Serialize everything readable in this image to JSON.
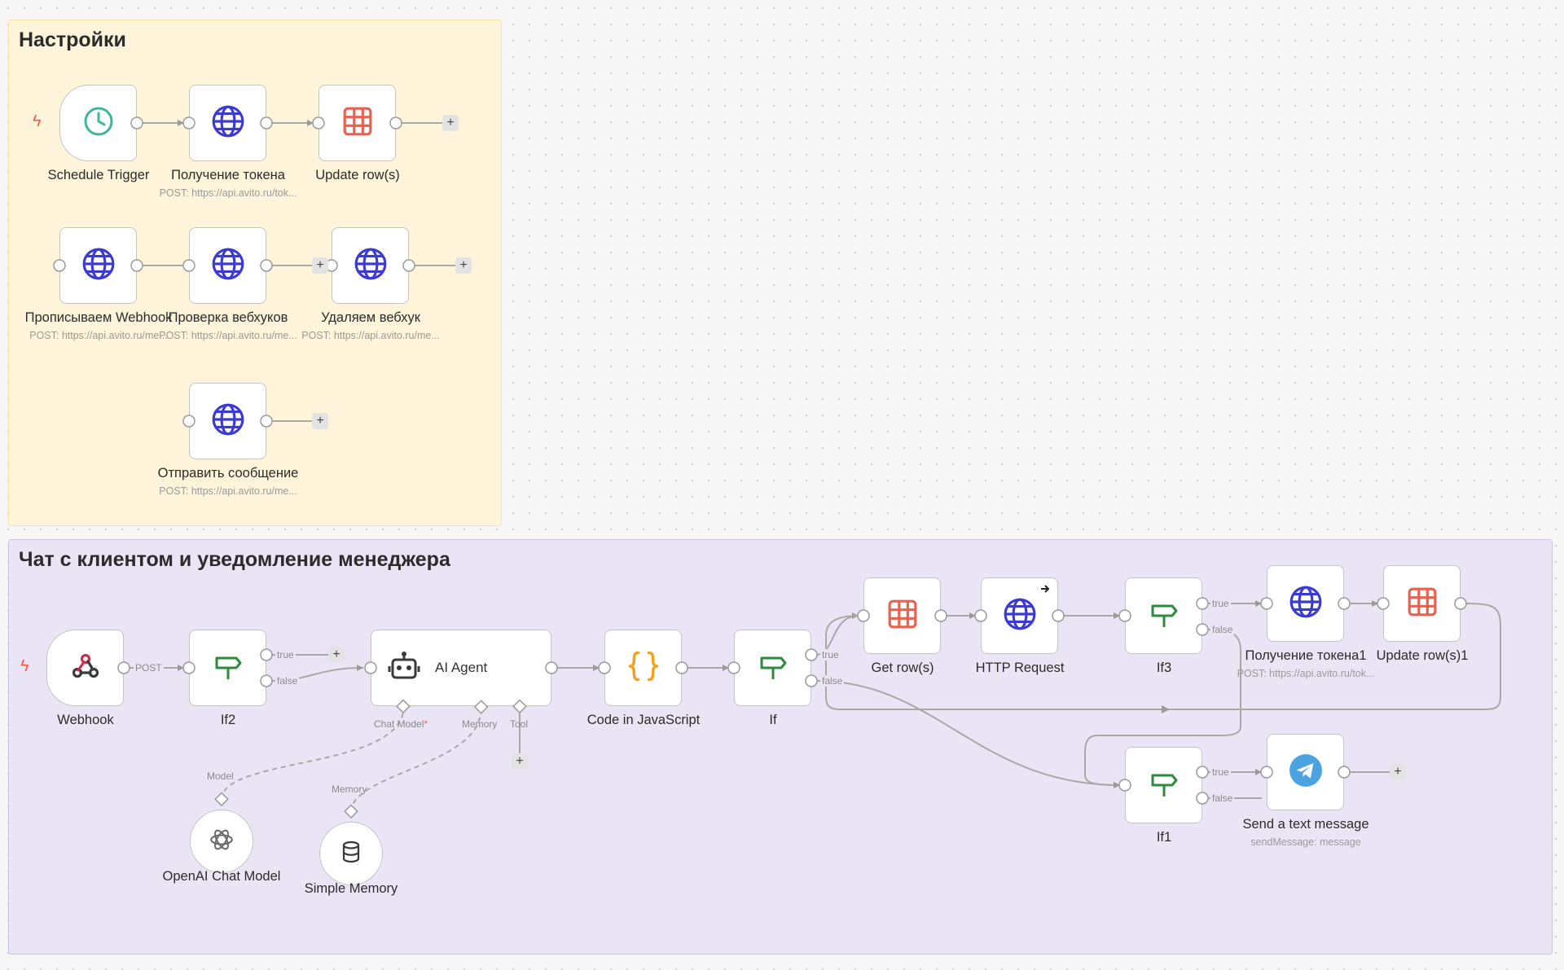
{
  "sticky_settings": {
    "title": "Настройки"
  },
  "sticky_chat": {
    "title": "Чат с клиентом и уведомление менеджера"
  },
  "nodes": {
    "schedule_trigger": {
      "label": "Schedule Trigger",
      "icon": "clock-icon"
    },
    "get_token": {
      "label": "Получение токена",
      "sub": "POST: https://api.avito.ru/tok...",
      "icon": "globe-icon"
    },
    "update_rows": {
      "label": "Update row(s)",
      "icon": "sheet-icon"
    },
    "register_webhook": {
      "label": "Прописываем Webhook",
      "sub": "POST: https://api.avito.ru/me...",
      "icon": "globe-icon"
    },
    "check_webhooks": {
      "label": "Проверка вебхуков",
      "sub": "POST: https://api.avito.ru/me...",
      "icon": "globe-icon"
    },
    "delete_webhook": {
      "label": "Удаляем вебхук",
      "sub": "POST: https://api.avito.ru/me...",
      "icon": "globe-icon"
    },
    "send_message_ru": {
      "label": "Отправить сообщение",
      "sub": "POST: https://api.avito.ru/me...",
      "icon": "globe-icon"
    },
    "webhook": {
      "label": "Webhook",
      "icon": "webhook-icon"
    },
    "if2": {
      "label": "If2",
      "icon": "signpost-icon"
    },
    "ai_agent": {
      "label": "AI Agent",
      "icon": "robot-icon"
    },
    "code_js": {
      "label": "Code in JavaScript",
      "icon": "braces-icon"
    },
    "if": {
      "label": "If",
      "icon": "signpost-icon"
    },
    "get_rows": {
      "label": "Get row(s)",
      "icon": "sheet-icon"
    },
    "http_request": {
      "label": "HTTP Request",
      "icon": "globe-icon"
    },
    "if3": {
      "label": "If3",
      "icon": "signpost-icon"
    },
    "get_token1": {
      "label": "Получение токена1",
      "sub": "POST: https://api.avito.ru/tok...",
      "icon": "globe-icon"
    },
    "update_rows1": {
      "label": "Update row(s)1",
      "icon": "sheet-icon"
    },
    "if1": {
      "label": "If1",
      "icon": "signpost-icon"
    },
    "send_text": {
      "label": "Send a text message",
      "sub": "sendMessage: message",
      "icon": "telegram-icon"
    },
    "openai_model": {
      "label": "OpenAI Chat Model",
      "icon": "openai-icon"
    },
    "simple_memory": {
      "label": "Simple Memory",
      "icon": "database-icon"
    }
  },
  "ports": {
    "post": "POST",
    "true": "true",
    "false": "false",
    "chat_model": "Chat Model",
    "chat_model_required": "*",
    "memory": "Memory",
    "tool": "Tool",
    "model": "Model"
  },
  "plus_symbol": "+",
  "trigger_symbol": "ϟ",
  "colors": {
    "settings_bg": "#fdf4d9",
    "settings_border": "#f6e3a8",
    "chat_bg": "#e9e5f5",
    "chat_border": "#c9c3e3",
    "globe": "#3b3bd1",
    "sheet": "#e8624f",
    "signpost": "#2f8a3e",
    "clock": "#3fb69a",
    "braces": "#f0a224",
    "telegram": "#4aa3df",
    "trigger_bolt": "#f25d47"
  }
}
